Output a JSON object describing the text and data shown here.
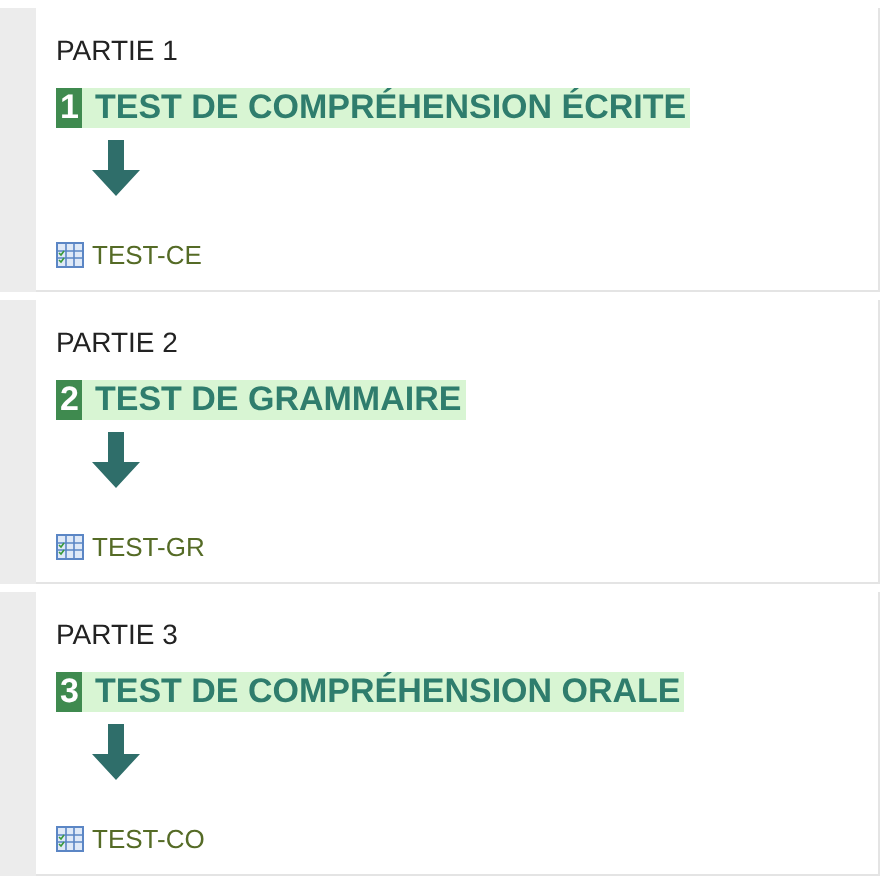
{
  "parts": [
    {
      "label": "PARTIE 1",
      "number": "1",
      "title": "TEST DE COMPRÉHENSION ÉCRITE",
      "link": "TEST-CE"
    },
    {
      "label": "PARTIE 2",
      "number": "2",
      "title": "TEST DE GRAMMAIRE",
      "link": "TEST-GR"
    },
    {
      "label": "PARTIE 3",
      "number": "3",
      "title": "TEST DE COMPRÉHENSION ORALE",
      "link": "TEST-CO"
    }
  ]
}
